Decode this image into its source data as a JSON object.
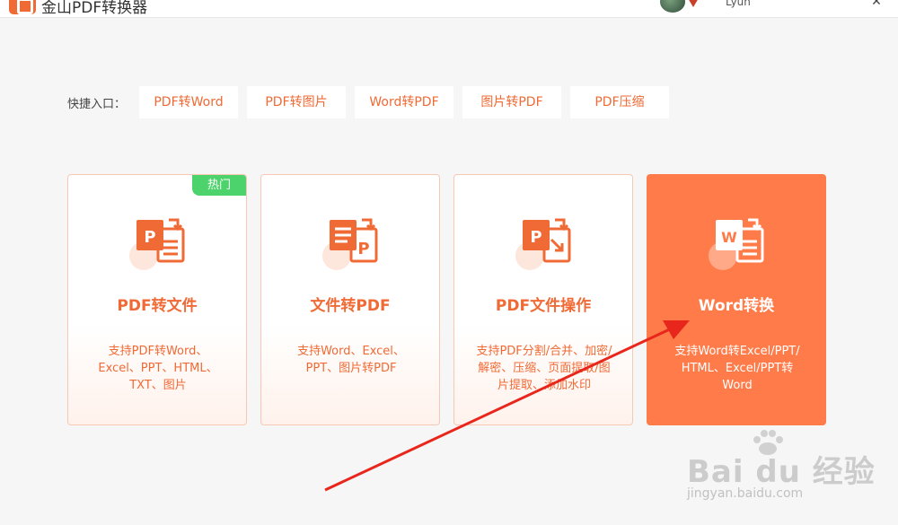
{
  "window": {
    "title": "金山PDF转换器",
    "username": "Lyun"
  },
  "quick_entry": {
    "label": "快捷入口：",
    "items": [
      {
        "label": "PDF转Word"
      },
      {
        "label": "PDF转图片"
      },
      {
        "label": "Word转PDF"
      },
      {
        "label": "图片转PDF"
      },
      {
        "label": "PDF压缩"
      }
    ]
  },
  "cards": [
    {
      "title": "PDF转文件",
      "badge": "热门",
      "icon": "pdf-to-file-icon",
      "desc_lines": [
        "支持PDF转Word、",
        "Excel、PPT、HTML、",
        "TXT、图片"
      ]
    },
    {
      "title": "文件转PDF",
      "icon": "file-to-pdf-icon",
      "desc_lines": [
        "支持Word、Excel、",
        "PPT、图片转PDF"
      ]
    },
    {
      "title": "PDF文件操作",
      "icon": "pdf-operations-icon",
      "desc_lines": [
        "支持PDF分割/合并、加密/",
        "解密、压缩、页面提取/图",
        "片提取、添加水印"
      ]
    },
    {
      "title": "Word转换",
      "icon": "word-convert-icon",
      "desc_lines": [
        "支持Word转Excel/PPT/",
        "HTML、Excel/PPT转",
        "Word"
      ]
    }
  ],
  "watermark": {
    "logo_text": "Bai du 经验",
    "url": "jingyan.baidu.com"
  },
  "colors": {
    "accent": "#f06a35",
    "active_card": "#ff7b49",
    "hot_badge": "#4cd36b",
    "annotation_arrow": "#e8261c"
  }
}
